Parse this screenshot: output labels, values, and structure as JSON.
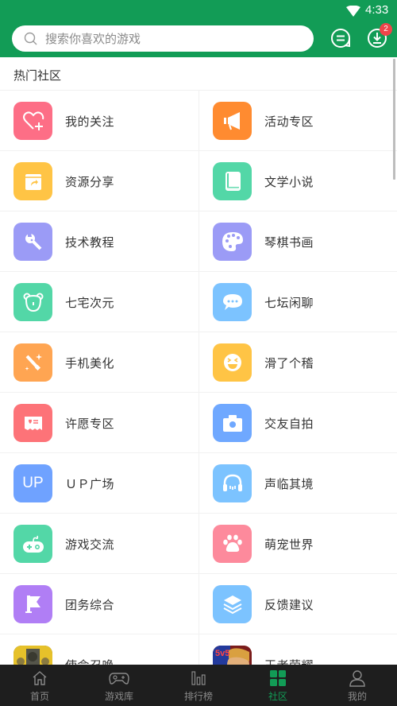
{
  "status_bar": {
    "time": "4:33",
    "wifi_icon": "wifi-icon"
  },
  "header": {
    "search_placeholder": "搜索你喜欢的游戏",
    "search_value": "",
    "message_icon": "message-icon",
    "download_icon": "download-icon",
    "download_badge": "2"
  },
  "section": {
    "title": "热门社区",
    "items": [
      {
        "label": "我的关注",
        "icon": "heart-plus-icon",
        "color": "#fd6e86"
      },
      {
        "label": "活动专区",
        "icon": "megaphone-icon",
        "color": "#ff8b30"
      },
      {
        "label": "资源分享",
        "icon": "share-box-icon",
        "color": "#ffc445"
      },
      {
        "label": "文学小说",
        "icon": "book-icon",
        "color": "#53d7a7"
      },
      {
        "label": "技术教程",
        "icon": "wrench-icon",
        "color": "#9b9bf6"
      },
      {
        "label": "琴棋书画",
        "icon": "palette-icon",
        "color": "#9b9bf6"
      },
      {
        "label": "七宅次元",
        "icon": "bear-icon",
        "color": "#53d7a7"
      },
      {
        "label": "七坛闲聊",
        "icon": "chat-bubble-icon",
        "color": "#7cc3ff"
      },
      {
        "label": "手机美化",
        "icon": "magic-wand-icon",
        "color": "#ffa552"
      },
      {
        "label": "滑了个稽",
        "icon": "laugh-face-icon",
        "color": "#ffc445"
      },
      {
        "label": "许愿专区",
        "icon": "wish-ticket-icon",
        "color": "#fd7378"
      },
      {
        "label": "交友自拍",
        "icon": "camera-icon",
        "color": "#6fa8ff"
      },
      {
        "label": "ＵＰ广场",
        "icon": "up-icon",
        "color": "#6fa2ff",
        "icon_text": "UP"
      },
      {
        "label": "声临其境",
        "icon": "headphones-icon",
        "color": "#7cc3ff"
      },
      {
        "label": "游戏交流",
        "icon": "gamepad-icon",
        "color": "#53d7a7"
      },
      {
        "label": "萌宠世界",
        "icon": "paw-icon",
        "color": "#fd8a9c"
      },
      {
        "label": "团务综合",
        "icon": "flag-icon",
        "color": "#b07ef5"
      },
      {
        "label": "反馈建议",
        "icon": "layers-icon",
        "color": "#7cc3ff"
      },
      {
        "label": "使命召唤",
        "icon": "call-of-duty-game-icon",
        "color": "#4a4a2c"
      },
      {
        "label": "王者荣耀",
        "icon": "honor-of-kings-game-icon",
        "color": "#b23a2a"
      }
    ]
  },
  "bottom_nav": {
    "items": [
      {
        "label": "首页",
        "icon": "home-icon",
        "active": false
      },
      {
        "label": "游戏库",
        "icon": "gamepad-icon",
        "active": false
      },
      {
        "label": "排行榜",
        "icon": "ranking-bars-icon",
        "active": false
      },
      {
        "label": "社区",
        "icon": "community-grid-icon",
        "active": true
      },
      {
        "label": "我的",
        "icon": "user-icon",
        "active": false
      }
    ],
    "active_color": "#129c56"
  },
  "colors": {
    "brand": "#129c56",
    "badge": "#f0444a",
    "nav_bg": "#1e1e1e"
  }
}
